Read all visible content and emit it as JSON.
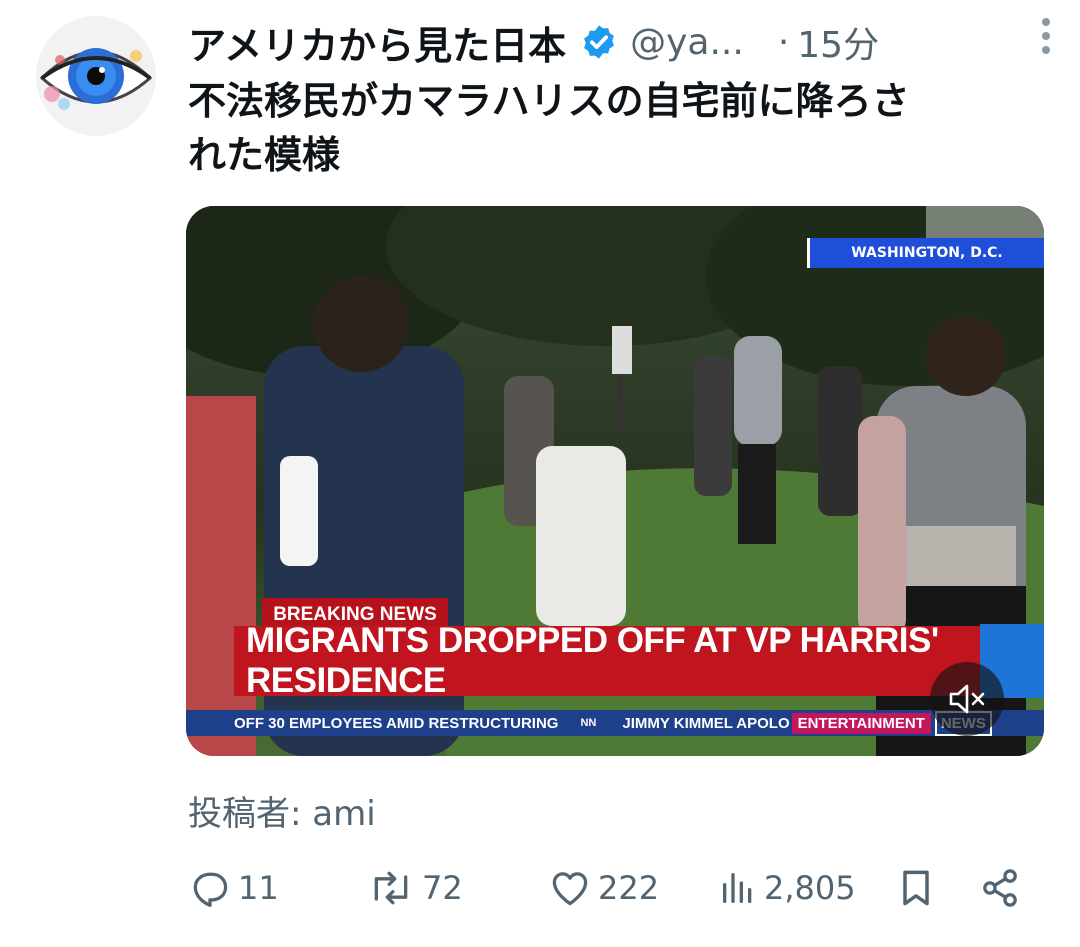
{
  "tweet": {
    "display_name": "アメリカから見た日本",
    "handle": "@ya...",
    "separator": "·",
    "time": "15分",
    "text_line1": "不法移民がカマラハリスの自宅前に降ろさ",
    "text_line2": "れた模様",
    "byline": "投稿者: ami"
  },
  "video": {
    "location_tag": "WASHINGTON, D.C.",
    "breaking_tag": "BREAKING NEWS",
    "headline": "MIGRANTS DROPPED OFF AT VP HARRIS' RESIDENCE",
    "ticker_left": "OFF 30 EMPLOYEES AMID RESTRUCTURING",
    "ticker_nn": "NN",
    "ticker_mid": "JIMMY KIMMEL APOLO",
    "ticker_entertainment": "ENTERTAINMENT",
    "ticker_news": "NEWS"
  },
  "actions": {
    "replies": "11",
    "reposts": "72",
    "likes": "222",
    "views": "2,805"
  },
  "icons": {
    "verified": "verified-badge-icon",
    "more": "more-vertical-icon",
    "reply": "reply-icon",
    "repost": "repost-icon",
    "like": "heart-icon",
    "views": "views-icon",
    "bookmark": "bookmark-icon",
    "share": "share-icon",
    "mute": "muted-speaker-icon"
  },
  "colors": {
    "verified_blue": "#1d9bf0",
    "muted_text": "#536471",
    "breaking_red": "#c0141e",
    "ticker_blue": "#1e3f8a"
  }
}
